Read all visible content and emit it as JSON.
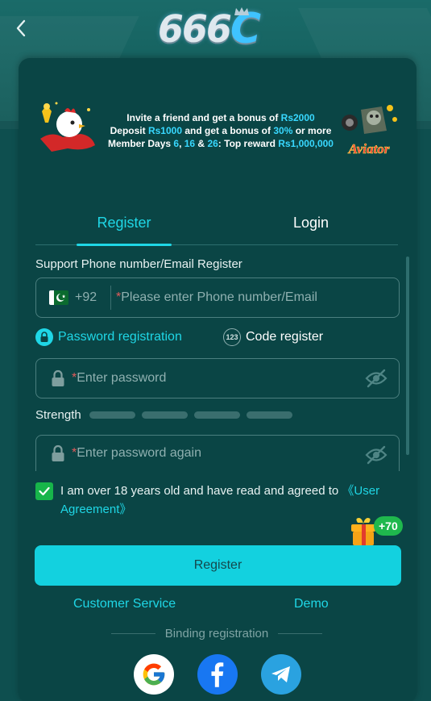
{
  "header": {
    "logo_text": "666",
    "logo_accent": "C",
    "back_icon": "chevron-left-icon"
  },
  "banner": {
    "line1_pre": "Invite a friend and get a bonus of ",
    "line1_hl": "Rs2000",
    "line2_pre": "Deposit ",
    "line2_hl1": "Rs1000",
    "line2_mid": " and get a bonus of ",
    "line2_hl2": "30%",
    "line2_post": " or more",
    "line3_pre": "Member Days ",
    "line3_hl1": "6",
    "line3_sep1": ", ",
    "line3_hl2": "16",
    "line3_sep2": " & ",
    "line3_hl3": "26",
    "line3_mid": ": Top reward ",
    "line3_hl4": "Rs1,000,000",
    "aviator_label": "Aviator"
  },
  "tabs": {
    "register": "Register",
    "login": "Login",
    "active": "register"
  },
  "form": {
    "section_label": "Support Phone number/Email Register",
    "country_code": "+92",
    "required_mark": "*",
    "phone_placeholder": "Please enter Phone number/Email",
    "mode_password": "Password registration",
    "mode_code": "Code register",
    "mode_code_icon_text": "123",
    "password_placeholder": "Enter password",
    "strength_label": "Strength",
    "password_again_placeholder": "Enter password again",
    "agree_text": "I am over 18 years old and have read and agreed to ",
    "agree_link": "《User Agreement》",
    "agree_checked": true
  },
  "gift": {
    "badge": "+70"
  },
  "actions": {
    "register_button": "Register",
    "customer_service": "Customer Service",
    "demo": "Demo"
  },
  "binding": {
    "label": "Binding registration",
    "providers": [
      "google-icon",
      "facebook-icon",
      "telegram-icon"
    ]
  },
  "colors": {
    "accent": "#1fd7e6",
    "button": "#13d1df",
    "background": "#0e4f4f",
    "card": "#0a4545",
    "checkbox": "#17b54a"
  }
}
